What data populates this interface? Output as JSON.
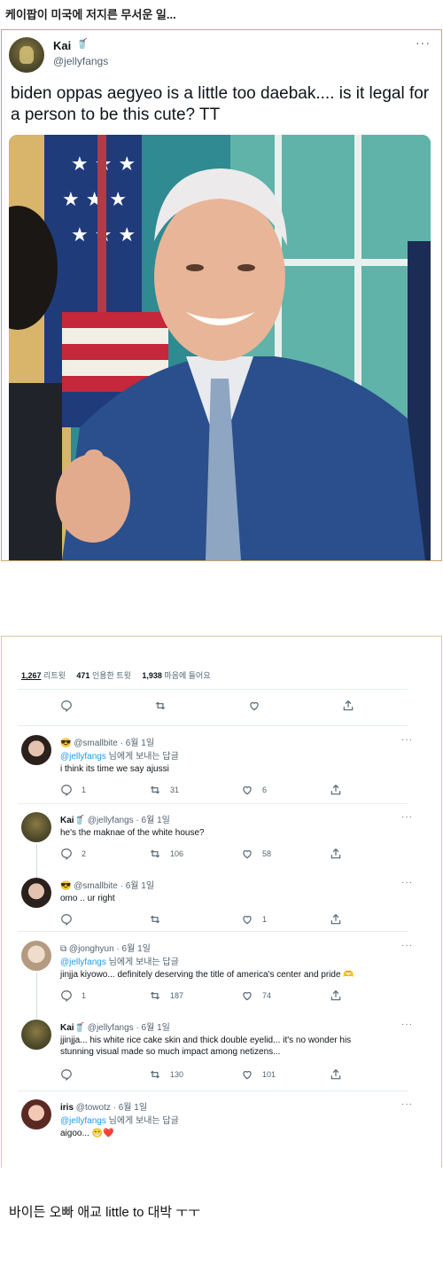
{
  "page_title": "케이팝이 미국에 저지른 무서운 일...",
  "tweet": {
    "name": "Kai",
    "name_emoji": "🥤",
    "handle": "@jellyfangs",
    "text": "biden oppas aegyeo is a little too daebak....  is it legal for a person to be this cute? TT",
    "more": "···"
  },
  "stats": {
    "retweets_count": "1,267",
    "retweets_label": "리트윗",
    "quotes_count": "471",
    "quotes_label": "인용한 트윗",
    "likes_count": "1,938",
    "likes_label": "마음에 들어요"
  },
  "replies": [
    {
      "emoji": "😎",
      "name": "",
      "handle": "@smallbite",
      "date": "· 6월 1일",
      "to_link": "@jellyfangs",
      "to_rest": " 님에게 보내는 답글",
      "text": "i think its time we say ajussi",
      "reply": "1",
      "retweet": "31",
      "like": "6"
    },
    {
      "emoji": "",
      "name": "Kai",
      "handle": "@jellyfangs",
      "date": "· 6월 1일",
      "to_link": "",
      "to_rest": "",
      "text": "he's the maknae of the white house?",
      "reply": "2",
      "retweet": "106",
      "like": "58"
    },
    {
      "emoji": "😎",
      "name": "",
      "handle": "@smallbite",
      "date": "· 6월 1일",
      "to_link": "",
      "to_rest": "",
      "text": "omo .. ur right",
      "reply": "",
      "retweet": "",
      "like": "1"
    },
    {
      "emoji": "",
      "name": "",
      "handle": "@jonghyun",
      "date": "· 6월 1일",
      "to_link": "@jellyfangs",
      "to_rest": " 님에게 보내는 답글",
      "text": "jinjja kiyowo... definitely deserving the title of america's center and pride 🫶",
      "reply": "1",
      "retweet": "187",
      "like": "74"
    },
    {
      "emoji": "",
      "name": "Kai",
      "handle": "@jellyfangs",
      "date": "· 6월 1일",
      "to_link": "",
      "to_rest": "",
      "text": "jjinjja... his white rice cake skin and thick double eyelid... it's no wonder his",
      "text2": "stunning visual made so much impact among netizens...",
      "reply": "",
      "retweet": "130",
      "like": "101"
    },
    {
      "emoji": "",
      "name": "iris",
      "handle": "@towotz",
      "date": "· 6월 1일",
      "to_link": "@jellyfangs",
      "to_rest": " 님에게 보내는 답글",
      "text": "aigoo... 😁❤️"
    }
  ],
  "caption": "바이든 오빠 애교 little to 대박 ㅜㅜ",
  "colors": {
    "link": "#1d9bf0",
    "muted": "#536471",
    "card_border": "#c9a86a"
  }
}
